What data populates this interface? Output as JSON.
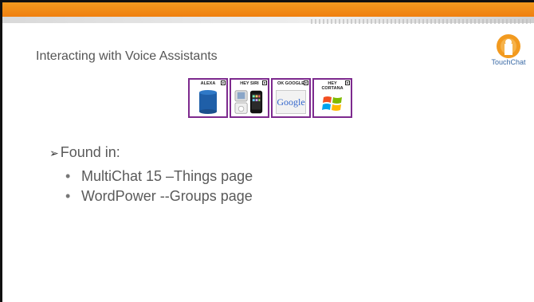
{
  "slide": {
    "title": "Interacting with Voice Assistants",
    "logo_text": "TouchChat"
  },
  "buttons": [
    {
      "label": "ALEXA",
      "icon": "alexa-cylinder-icon"
    },
    {
      "label": "HEY SIRI",
      "icon": "apple-devices-icon"
    },
    {
      "label": "OK GOOGLE",
      "icon": "google-logo-icon",
      "art_text": "Google"
    },
    {
      "label": "HEY\nCORTANA",
      "icon": "windows-logo-icon"
    }
  ],
  "bullets": {
    "main": "Found in:",
    "sub": [
      "MultiChat 15 –Things page",
      "WordPower --Groups page"
    ]
  },
  "colors": {
    "accent_orange": "#f28a14",
    "button_border": "#7d2a8e",
    "alexa_blue": "#1f5fa8"
  }
}
